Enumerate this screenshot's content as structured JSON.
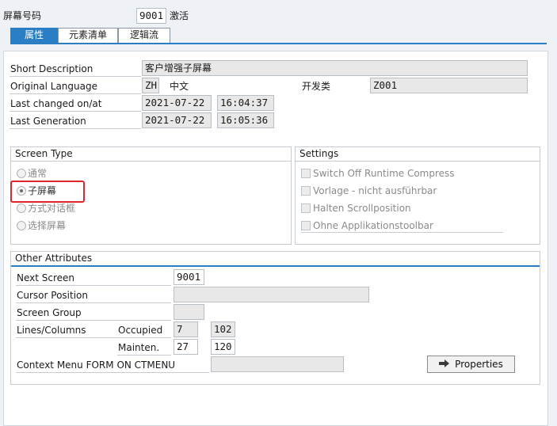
{
  "header": {
    "screen_no_label": "屏幕号码",
    "screen_no": "9001",
    "status": "激活"
  },
  "tabs": [
    {
      "label": "属性",
      "active": true
    },
    {
      "label": "元素清单",
      "active": false
    },
    {
      "label": "逻辑流",
      "active": false
    }
  ],
  "general": {
    "short_desc_label": "Short Description",
    "short_desc": "客户增强子屏幕",
    "orig_lang_label": "Original Language",
    "orig_lang_code": "ZH",
    "orig_lang_name": "中文",
    "dev_class_label": "开发类",
    "dev_class": "Z001",
    "last_changed_label": "Last changed on/at",
    "last_changed_date": "2021-07-22",
    "last_changed_time": "16:04:37",
    "last_gen_label": "Last Generation",
    "last_gen_date": "2021-07-22",
    "last_gen_time": "16:05:36"
  },
  "screen_type": {
    "title": "Screen Type",
    "options": [
      {
        "label": "通常",
        "checked": false
      },
      {
        "label": "子屏幕",
        "checked": true
      },
      {
        "label": "方式对话框",
        "checked": false
      },
      {
        "label": "选择屏幕",
        "checked": false
      }
    ]
  },
  "settings": {
    "title": "Settings",
    "options": [
      {
        "label": "Switch Off Runtime Compress"
      },
      {
        "label": "Vorlage - nicht ausführbar"
      },
      {
        "label": "Halten Scrollposition"
      },
      {
        "label": "Ohne Applikationstoolbar"
      }
    ]
  },
  "other": {
    "title": "Other Attributes",
    "next_screen_label": "Next Screen",
    "next_screen": "9001",
    "cursor_label": "Cursor Position",
    "cursor": "",
    "screen_group_label": "Screen Group",
    "screen_group": "",
    "lines_cols_label": "Lines/Columns",
    "occupied_label": "Occupied",
    "occupied_lines": "7",
    "occupied_cols": "102",
    "mainten_label": "Mainten.",
    "mainten_lines": "27",
    "mainten_cols": "120",
    "ctx_label": "Context Menu FORM ON CTMENU",
    "ctx_value": "",
    "properties_button": "Properties"
  },
  "colors": {
    "accent": "#2a7ec4",
    "highlight": "#e0262b"
  }
}
